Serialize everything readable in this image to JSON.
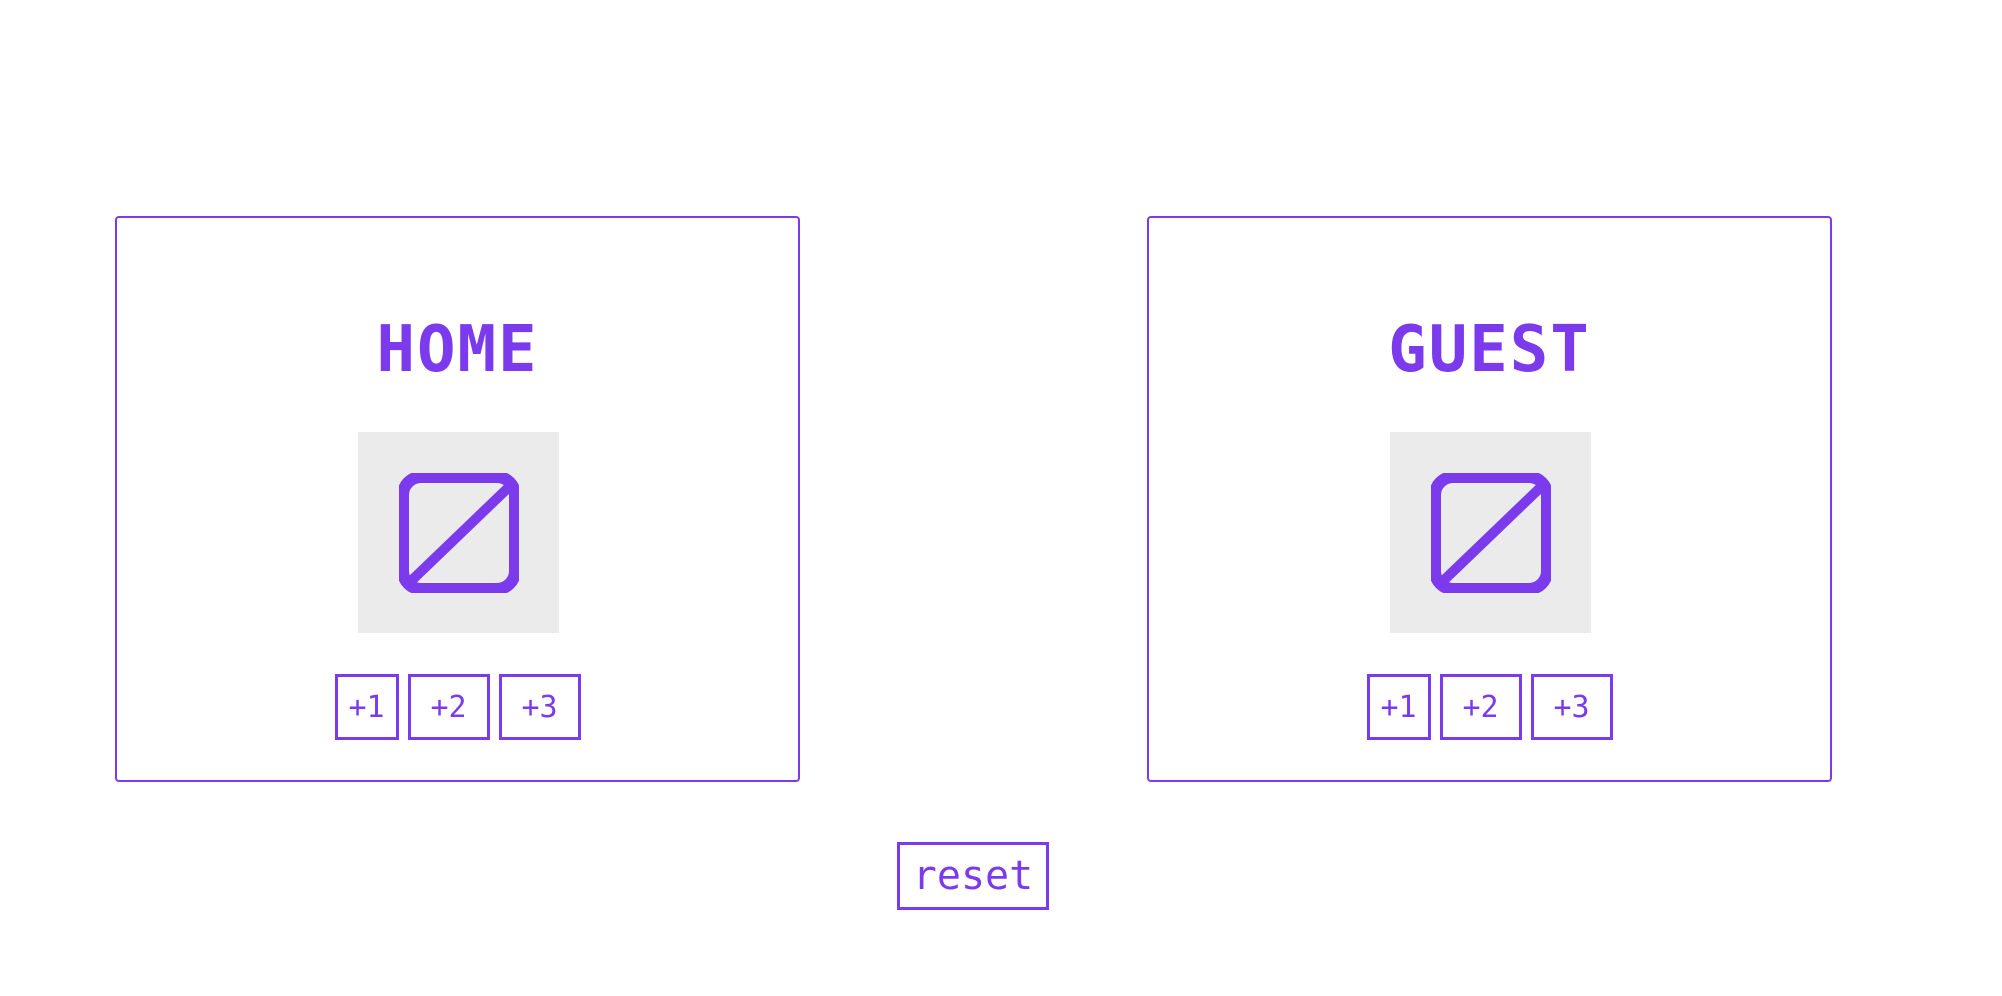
{
  "accent_color": "#7c3aed",
  "home": {
    "name": "HOME",
    "score_icon": "zero-slashed-icon",
    "buttons": [
      "+1",
      "+2",
      "+3"
    ]
  },
  "guest": {
    "name": "GUEST",
    "score_icon": "zero-slashed-icon",
    "buttons": [
      "+1",
      "+2",
      "+3"
    ]
  },
  "reset_label": "reset"
}
